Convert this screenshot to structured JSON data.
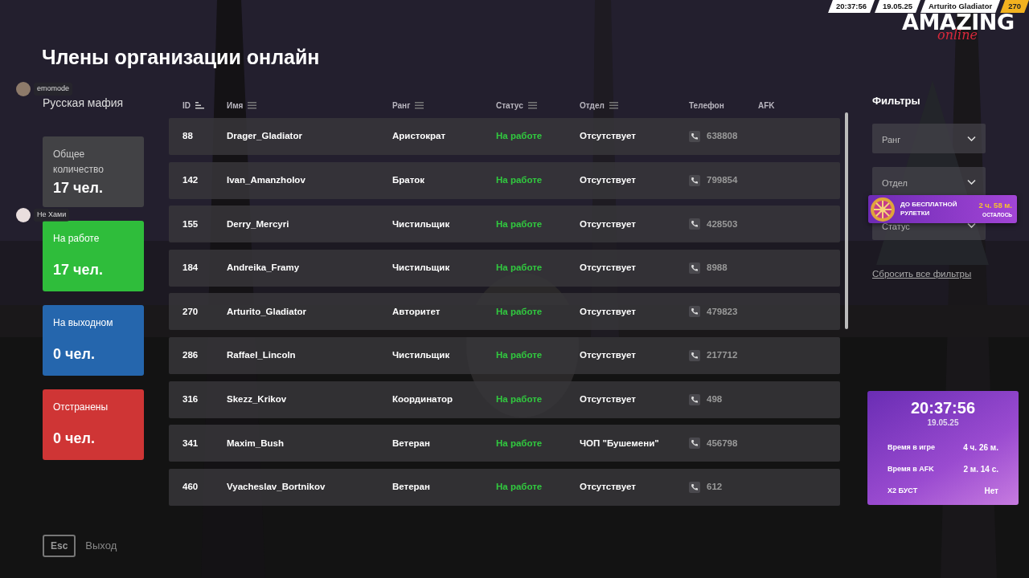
{
  "hud": {
    "time": "20:37:56",
    "date": "19.05.25",
    "player": "Arturito Gladiator",
    "level": "270"
  },
  "logo": {
    "main": "AMAZING",
    "sub": "online"
  },
  "title": "Члены организации онлайн",
  "organization": "Русская мафия",
  "voice_chat": [
    {
      "name": "emomode"
    },
    {
      "name": "Не Хами"
    }
  ],
  "summary_cards": [
    {
      "kind": "total",
      "label": "Общее количество",
      "value": "17 чел."
    },
    {
      "kind": "working",
      "label": "На работе",
      "value": "17 чел."
    },
    {
      "kind": "off",
      "label": "На выходном",
      "value": "0 чел."
    },
    {
      "kind": "suspended",
      "label": "Отстранены",
      "value": "0 чел."
    }
  ],
  "table": {
    "columns": [
      {
        "label": "ID",
        "kind": "sorted"
      },
      {
        "label": "Имя",
        "kind": "menu"
      },
      {
        "label": "Ранг",
        "kind": "menu"
      },
      {
        "label": "Статус",
        "kind": "menu"
      },
      {
        "label": "Отдел",
        "kind": "menu"
      },
      {
        "label": "Телефон",
        "kind": "plain"
      },
      {
        "label": "AFK",
        "kind": "plain"
      }
    ],
    "rows": [
      {
        "id": "88",
        "name": "Drager_Gladiator",
        "rank": "Аристократ",
        "status": "На работе",
        "department": "Отсутствует",
        "phone": "638808"
      },
      {
        "id": "142",
        "name": "Ivan_Amanzholov",
        "rank": "Браток",
        "status": "На работе",
        "department": "Отсутствует",
        "phone": "799854"
      },
      {
        "id": "155",
        "name": "Derry_Mercyri",
        "rank": "Чистильщик",
        "status": "На работе",
        "department": "Отсутствует",
        "phone": "428503"
      },
      {
        "id": "184",
        "name": "Andreika_Framy",
        "rank": "Чистильщик",
        "status": "На работе",
        "department": "Отсутствует",
        "phone": "8988"
      },
      {
        "id": "270",
        "name": "Arturito_Gladiator",
        "rank": "Авторитет",
        "status": "На работе",
        "department": "Отсутствует",
        "phone": "479823"
      },
      {
        "id": "286",
        "name": "Raffael_Lincoln",
        "rank": "Чистильщик",
        "status": "На работе",
        "department": "Отсутствует",
        "phone": "217712"
      },
      {
        "id": "316",
        "name": "Skezz_Krikov",
        "rank": "Координатор",
        "status": "На работе",
        "department": "Отсутствует",
        "phone": "498"
      },
      {
        "id": "341",
        "name": "Maxim_Bush",
        "rank": "Ветеран",
        "status": "На работе",
        "department": "ЧОП \"Бушемени\"",
        "phone": "456798"
      },
      {
        "id": "460",
        "name": "Vyacheslav_Bortnikov",
        "rank": "Ветеран",
        "status": "На работе",
        "department": "Отсутствует",
        "phone": "612"
      }
    ]
  },
  "filters": {
    "title": "Фильтры",
    "selects": [
      {
        "placeholder": "Ранг"
      },
      {
        "placeholder": "Отдел"
      },
      {
        "placeholder": "Статус"
      }
    ],
    "reset": "Сбросить все фильтры"
  },
  "promo": {
    "line1": "ДО БЕСПЛАТНОЙ",
    "line2": "РУЛЕТКИ",
    "time": "2 ч. 58 м.",
    "note": "ОСТАЛОСЬ"
  },
  "clock_card": {
    "time": "20:37:56",
    "date": "19.05.25",
    "stats": [
      {
        "label": "Время в игре",
        "value": "4 ч. 26 м."
      },
      {
        "label": "Время в AFK",
        "value": "2 м. 14 с."
      },
      {
        "label": "X2 БУСТ",
        "value": "Нет"
      }
    ]
  },
  "exit": {
    "key": "Esc",
    "label": "Выход"
  }
}
